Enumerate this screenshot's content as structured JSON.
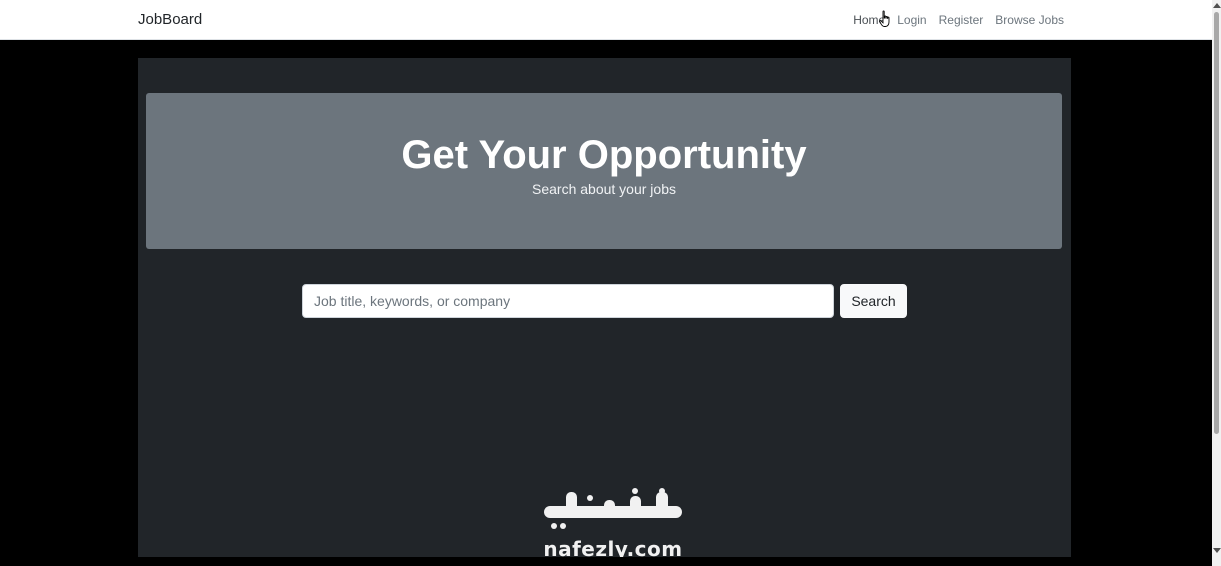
{
  "navbar": {
    "brand": "JobBoard",
    "links": [
      {
        "label": "Home"
      },
      {
        "label": "Login"
      },
      {
        "label": "Register"
      },
      {
        "label": "Browse Jobs"
      }
    ]
  },
  "hero": {
    "title": "Get Your Opportunity",
    "subtitle": "Search about your jobs"
  },
  "search": {
    "value": "",
    "placeholder": "Job title, keywords, or company",
    "button_label": "Search"
  },
  "watermark": {
    "domain": "nafezly.com"
  },
  "colors": {
    "navbar_bg": "#ffffff",
    "page_bg": "#000000",
    "container_bg": "#212529",
    "hero_bg": "#6c757d",
    "button_bg": "#f8f9fa"
  },
  "icons": {
    "cursor": "hand-pointer-icon"
  }
}
